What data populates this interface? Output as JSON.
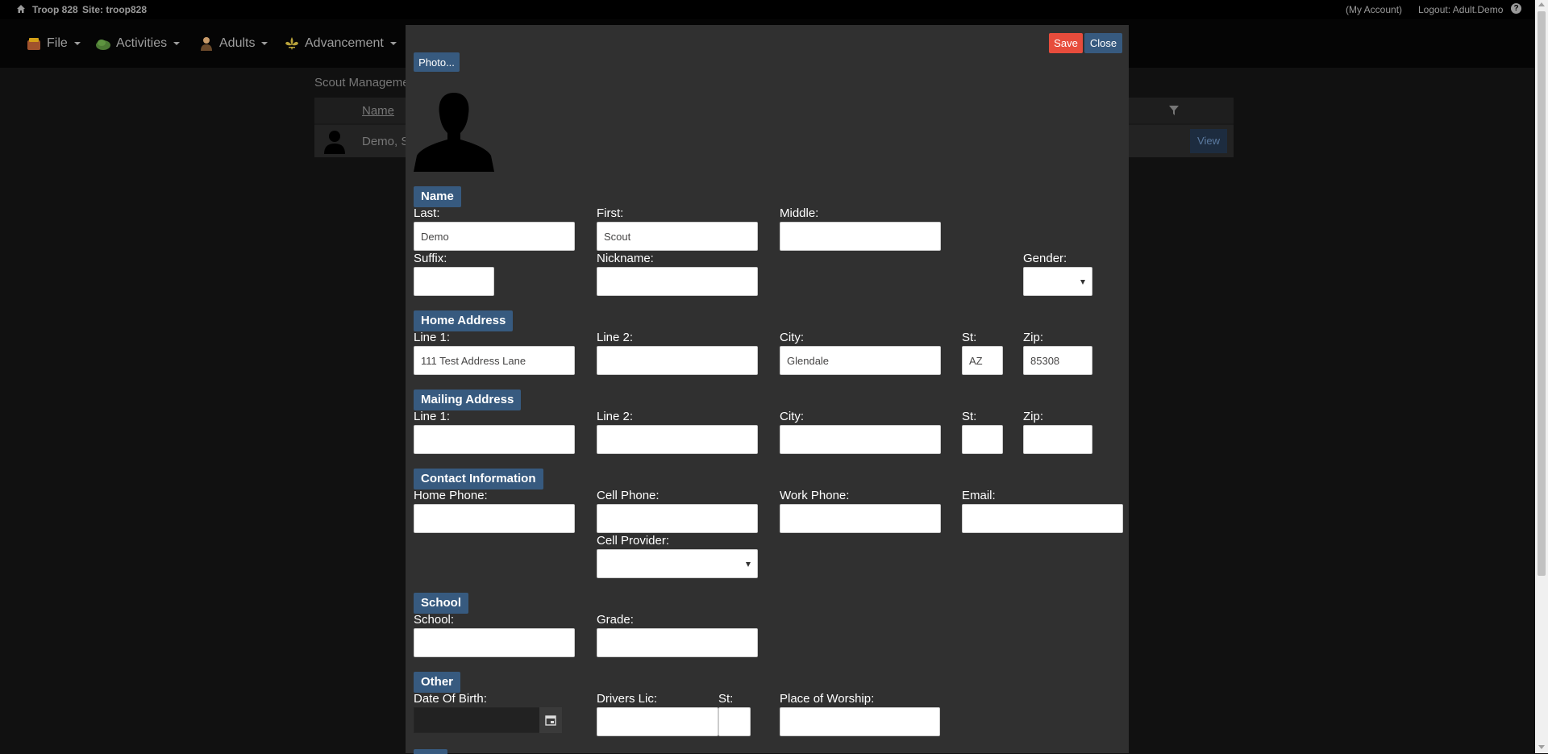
{
  "topbar": {
    "troop": "Troop 828",
    "site": "Site: troop828",
    "my_account": "(My Account)",
    "logout": "Logout: Adult.Demo",
    "help": "?"
  },
  "nav": {
    "file": "File",
    "activities": "Activities",
    "adults": "Adults",
    "advancement": "Advancement"
  },
  "background": {
    "page_title": "Scout Manageme",
    "column_name": "Name",
    "row_name": "Demo, S",
    "view_label": "View"
  },
  "modal": {
    "save_label": "Save",
    "close_label": "Close",
    "photo_label": "Photo...",
    "name_section": "Name",
    "last_label": "Last:",
    "last_value": "Demo",
    "first_label": "First:",
    "first_value": "Scout",
    "middle_label": "Middle:",
    "middle_value": "",
    "suffix_label": "Suffix:",
    "suffix_value": "",
    "nickname_label": "Nickname:",
    "nickname_value": "",
    "gender_label": "Gender:",
    "gender_value": "",
    "home_section": "Home Address",
    "home_line1_label": "Line 1:",
    "home_line1_value": "111 Test Address Lane",
    "home_line2_label": "Line 2:",
    "home_line2_value": "",
    "home_city_label": "City:",
    "home_city_value": "Glendale",
    "home_st_label": "St:",
    "home_st_value": "AZ",
    "home_zip_label": "Zip:",
    "home_zip_value": "85308",
    "mail_section": "Mailing Address",
    "mail_line1_label": "Line 1:",
    "mail_line2_label": "Line 2:",
    "mail_city_label": "City:",
    "mail_st_label": "St:",
    "mail_zip_label": "Zip:",
    "contact_section": "Contact Information",
    "home_phone_label": "Home Phone:",
    "cell_phone_label": "Cell Phone:",
    "work_phone_label": "Work Phone:",
    "email_label": "Email:",
    "cell_provider_label": "Cell Provider:",
    "school_section": "School",
    "school_label": "School:",
    "grade_label": "Grade:",
    "other_section": "Other",
    "dob_label": "Date Of Birth:",
    "drivers_lic_label": "Drivers Lic:",
    "dl_st_label": "St:",
    "worship_label": "Place of Worship:"
  },
  "colors": {
    "primary": "#375a7f",
    "danger": "#e74c3c",
    "modal_bg": "#303030",
    "page_bg": "#111111"
  }
}
